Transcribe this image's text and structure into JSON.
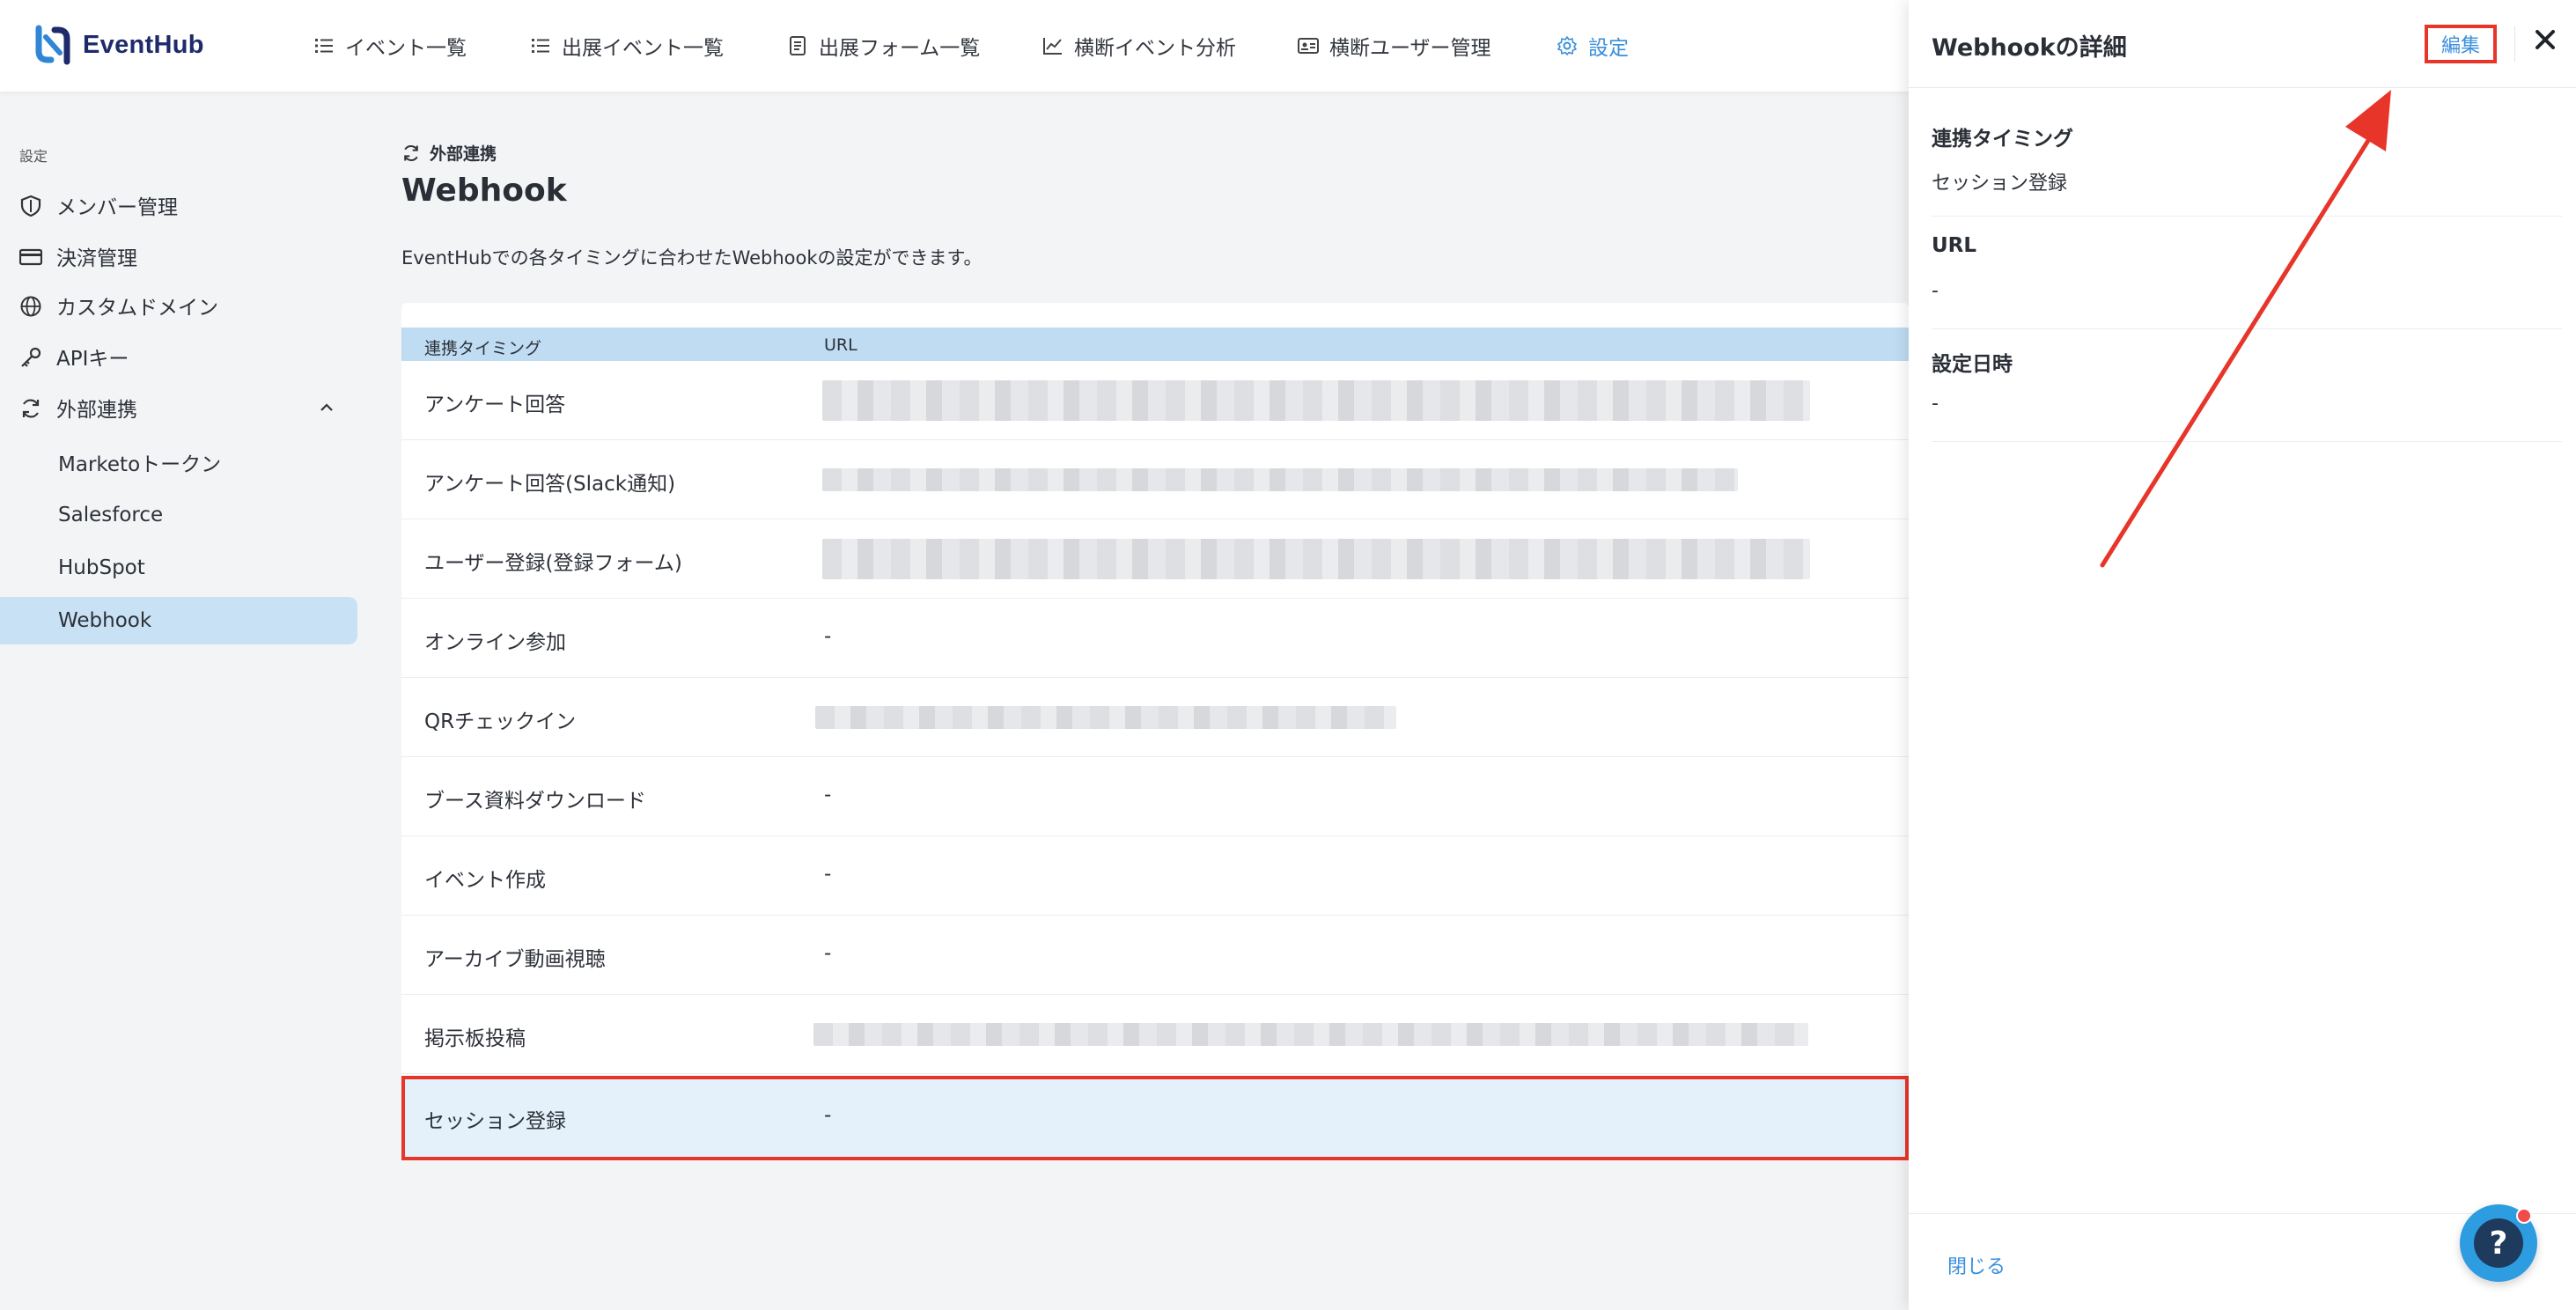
{
  "app": {
    "logo_text": "EventHub"
  },
  "nav": [
    {
      "label": "イベント一覧",
      "icon": "list-icon"
    },
    {
      "label": "出展イベント一覧",
      "icon": "list-icon"
    },
    {
      "label": "出展フォーム一覧",
      "icon": "form-icon"
    },
    {
      "label": "横断イベント分析",
      "icon": "chart-line-icon"
    },
    {
      "label": "横断ユーザー管理",
      "icon": "id-card-icon"
    },
    {
      "label": "設定",
      "icon": "gear-icon",
      "active": true
    }
  ],
  "sidebar": {
    "caption": "設定",
    "items": [
      {
        "label": "メンバー管理",
        "icon": "shield-icon"
      },
      {
        "label": "決済管理",
        "icon": "credit-card-icon"
      },
      {
        "label": "カスタムドメイン",
        "icon": "globe-icon"
      },
      {
        "label": "APIキー",
        "icon": "key-icon"
      },
      {
        "label": "外部連携",
        "icon": "sync-icon",
        "expanded": true
      }
    ],
    "sub_items": [
      {
        "label": "Marketoトークン"
      },
      {
        "label": "Salesforce"
      },
      {
        "label": "HubSpot"
      },
      {
        "label": "Webhook",
        "active": true
      }
    ]
  },
  "main": {
    "breadcrumb": "外部連携",
    "title": "Webhook",
    "description": "EventHubでの各タイミングに合わせたWebhookの設定ができます。",
    "table": {
      "headers": [
        "連携タイミング",
        "URL"
      ],
      "rows": [
        {
          "timing": "アンケート回答",
          "url": "",
          "blurred": true
        },
        {
          "timing": "アンケート回答(Slack通知)",
          "url": "",
          "blurred": true
        },
        {
          "timing": "ユーザー登録(登録フォーム)",
          "url": "",
          "blurred": true
        },
        {
          "timing": "オンライン参加",
          "url": "-"
        },
        {
          "timing": "QRチェックイン",
          "url": "",
          "blurred": true
        },
        {
          "timing": "ブース資料ダウンロード",
          "url": "-"
        },
        {
          "timing": "イベント作成",
          "url": "-"
        },
        {
          "timing": "アーカイブ動画視聴",
          "url": "-"
        },
        {
          "timing": "掲示板投稿",
          "url": "",
          "blurred": true
        },
        {
          "timing": "セッション登録",
          "url": "-",
          "selected": true
        }
      ]
    }
  },
  "drawer": {
    "title": "Webhookの詳細",
    "edit_label": "編集",
    "fields": [
      {
        "label": "連携タイミング",
        "value": "セッション登録"
      },
      {
        "label": "URL",
        "value": "-"
      },
      {
        "label": "設定日時",
        "value": "-"
      }
    ],
    "close_label": "閉じる"
  },
  "colors": {
    "accent": "#3a8fdc",
    "highlight_red": "#e8352a",
    "header_blue": "#bfdcf2",
    "selected_row": "#e4f1fa",
    "sidebar_active": "#c9e1f4"
  },
  "help": {
    "glyph": "?"
  }
}
